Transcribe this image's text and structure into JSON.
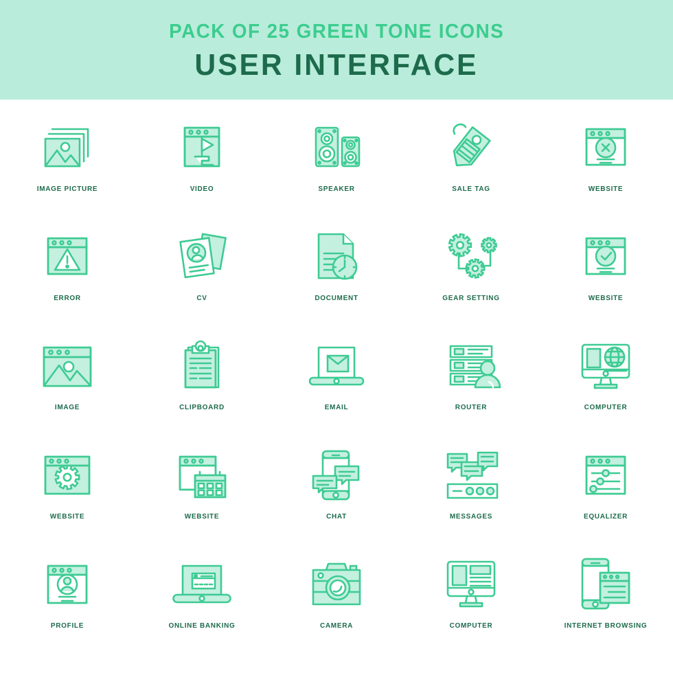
{
  "header": {
    "subtitle": "PACK OF 25 GREEN TONE ICONS",
    "title": "USER INTERFACE",
    "bg_color": "#b9ecdb",
    "subtitle_color": "#3ccd8e",
    "title_color": "#1d6b4c"
  },
  "theme": {
    "stroke_color": "#3ecb93",
    "fill_color": "#c4f0e0",
    "label_color": "#1d6b4c",
    "page_bg": "#ffffff"
  },
  "icons": [
    {
      "id": "image-picture",
      "label": "IMAGE PICTURE",
      "row": 1,
      "col": 1
    },
    {
      "id": "video",
      "label": "VIDEO",
      "row": 1,
      "col": 2
    },
    {
      "id": "speaker",
      "label": "SPEAKER",
      "row": 1,
      "col": 3
    },
    {
      "id": "sale-tag",
      "label": "SALE TAG",
      "row": 1,
      "col": 4
    },
    {
      "id": "website-close",
      "label": "WEBSITE",
      "row": 1,
      "col": 5
    },
    {
      "id": "error",
      "label": "ERROR",
      "row": 2,
      "col": 1
    },
    {
      "id": "cv",
      "label": "CV",
      "row": 2,
      "col": 2
    },
    {
      "id": "document",
      "label": "DOCUMENT",
      "row": 2,
      "col": 3
    },
    {
      "id": "gear-setting",
      "label": "GEAR SETTING",
      "row": 2,
      "col": 4
    },
    {
      "id": "website-check",
      "label": "WEBSITE",
      "row": 2,
      "col": 5
    },
    {
      "id": "image",
      "label": "IMAGE",
      "row": 3,
      "col": 1
    },
    {
      "id": "clipboard",
      "label": "CLIPBOARD",
      "row": 3,
      "col": 2
    },
    {
      "id": "email",
      "label": "EMAIL",
      "row": 3,
      "col": 3
    },
    {
      "id": "router",
      "label": "ROUTER",
      "row": 3,
      "col": 4
    },
    {
      "id": "computer-globe",
      "label": "COMPUTER",
      "row": 3,
      "col": 5
    },
    {
      "id": "website-gear",
      "label": "WEBSITE",
      "row": 4,
      "col": 1
    },
    {
      "id": "website-calendar",
      "label": "WEBSITE",
      "row": 4,
      "col": 2
    },
    {
      "id": "chat",
      "label": "CHAT",
      "row": 4,
      "col": 3
    },
    {
      "id": "messages",
      "label": "MESSAGES",
      "row": 4,
      "col": 4
    },
    {
      "id": "equalizer",
      "label": "EQUALIZER",
      "row": 4,
      "col": 5
    },
    {
      "id": "profile",
      "label": "PROFILE",
      "row": 5,
      "col": 1
    },
    {
      "id": "online-banking",
      "label": "ONLINE BANKING",
      "row": 5,
      "col": 2
    },
    {
      "id": "camera",
      "label": "CAMERA",
      "row": 5,
      "col": 3
    },
    {
      "id": "computer-layout",
      "label": "COMPUTER",
      "row": 5,
      "col": 4
    },
    {
      "id": "internet-browsing",
      "label": "INTERNET BROWSING",
      "row": 5,
      "col": 5
    }
  ]
}
